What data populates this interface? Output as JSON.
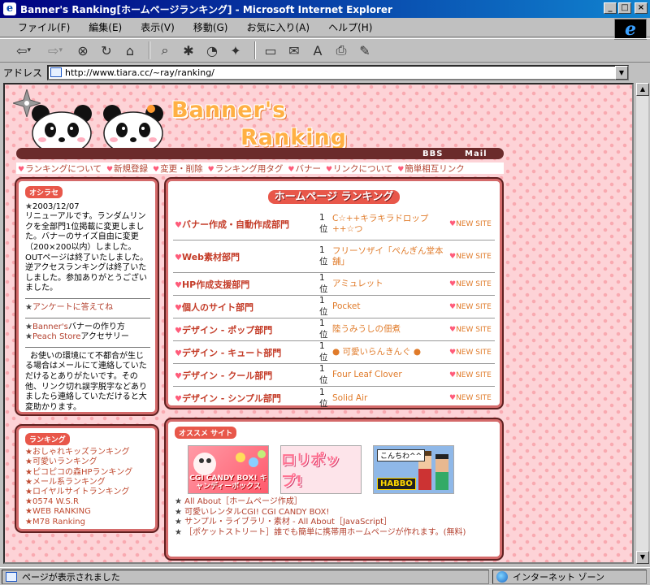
{
  "window": {
    "title": "Banner's Ranking[ホームページランキング] - Microsoft Internet Explorer",
    "icon": "ie-icon",
    "controls": [
      "_",
      "□",
      "×"
    ]
  },
  "menu": [
    "ファイル(F)",
    "編集(E)",
    "表示(V)",
    "移動(G)",
    "お気に入り(A)",
    "ヘルプ(H)"
  ],
  "toolbar": {
    "icons": [
      "back-icon",
      "forward-icon",
      "stop-icon",
      "refresh-icon",
      "home-icon",
      "search-icon",
      "favorites-icon",
      "history-icon",
      "channels-icon",
      "fullscreen-icon",
      "mail-icon",
      "font-icon",
      "print-icon",
      "edit-icon"
    ],
    "glyphs": {
      "back": "⇦",
      "forward": "⇨",
      "stop": "⊗",
      "refresh": "↻",
      "home": "⌂",
      "search": "⌕",
      "favorites": "✱",
      "history": "◔",
      "channels": "✦",
      "fullscreen": "▭",
      "mail": "✉",
      "font": "A",
      "print": "⎙",
      "edit": "✎",
      "dropdown": "▾"
    }
  },
  "address": {
    "label": "アドレス",
    "url": "http://www.tiara.cc/~ray/ranking/",
    "dropdown": "▼"
  },
  "header": {
    "title_line1": "Banner's",
    "title_line2": "Ranking",
    "link_bbs": "BBS",
    "link_mail": "Mail"
  },
  "nav": [
    "ランキングについて",
    "新規登録",
    "変更・削除",
    "ランキング用タグ",
    "バナー",
    "リンクについて",
    "簡単相互リンク"
  ],
  "heart": "♥",
  "star": "★",
  "news": {
    "badge": "オシラセ",
    "date": "2003/12/07",
    "body": "リニューアルです。ランダムリンクを全部門1位掲載に変更しました。バナーのサイズ自由に変更（200×200以内）しました。OUTページは終了いたしました。逆アクセスランキングは終了いたしました。参加ありがとうございました。",
    "links": [
      "アンケートに答えてね"
    ],
    "links2_a": "Banner's",
    "links2_a_rest": "バナーの作り方",
    "links2_b": "Peach Store",
    "links2_b_rest": "アクセサリー",
    "notice": "お使いの環境にて不都合が生じる場合はメールにて連絡していただけるとありがたいです。その他、リンク切れ誤字脱字などありましたら連絡していただけると大変助かります。"
  },
  "ranking_list": {
    "badge": "ランキング",
    "items": [
      "おしゃれキッズランキング",
      "可愛いランキング",
      "ピコピコの森HPランキング",
      "メール系ランキング",
      "ロイヤルサイトランキング",
      "0574 W.S.R",
      "WEB RANKING",
      "M78 Ranking"
    ]
  },
  "hp_ranking": {
    "title": "ホームページ ランキング",
    "rank_label": "1位",
    "new_label": "NEW SITE",
    "rows": [
      {
        "category": "バナー作成・自動作成部門",
        "site": "C☆++キラキラドロップ++☆つ"
      },
      {
        "category": "Web素材部門",
        "site": "フリーソザイ「ぺんぎん堂本舗」"
      },
      {
        "category": "HP作成支援部門",
        "site": "アミュレット"
      },
      {
        "category": "個人のサイト部門",
        "site": "Pocket"
      },
      {
        "category": "デザイン - ポップ部門",
        "site": "陸うみうしの佃煮"
      },
      {
        "category": "デザイン - キュート部門",
        "site": "● 可愛いらんきんぐ ●"
      },
      {
        "category": "デザイン - クール部門",
        "site": "Four Leaf Clover"
      },
      {
        "category": "デザイン - シンプル部門",
        "site": "Solid Air"
      }
    ]
  },
  "osusume": {
    "badge": "オススメ サイト",
    "banner1": "CGI CANDY BOX! キャンディーボックス",
    "banner2": "ロリポップ!",
    "banner3_bubble": "こんちわ^^",
    "banner3_logo": "HABBO",
    "links": [
      "All About［ホームページ作成］",
      "可愛いレンタルCGI! CGI CANDY BOX!",
      "サンプル・ライブラリ・素材 - All About［JavaScript］",
      "［ポケットストリート］誰でも簡単に携帯用ホームページが作れます。(無料)"
    ]
  },
  "status": {
    "left": "ページが表示されました",
    "right": "インターネット ゾーン"
  },
  "colors": {
    "accent": "#e8574a",
    "link": "#b3402e",
    "site": "#e07b2a",
    "bg_pink": "#fdd3d7"
  }
}
